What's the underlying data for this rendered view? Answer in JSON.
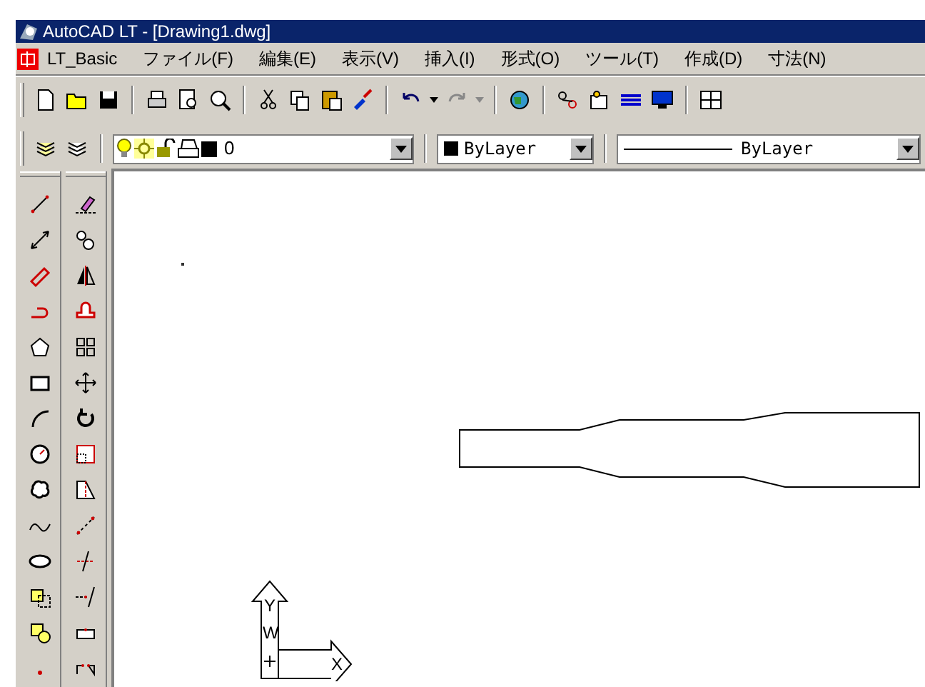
{
  "window": {
    "title": "AutoCAD LT - [Drawing1.dwg]"
  },
  "menu": [
    {
      "label": "LT_Basic"
    },
    {
      "label": "ファイル(F)"
    },
    {
      "label": "編集(E)"
    },
    {
      "label": "表示(V)"
    },
    {
      "label": "挿入(I)"
    },
    {
      "label": "形式(O)"
    },
    {
      "label": "ツール(T)"
    },
    {
      "label": "作成(D)"
    },
    {
      "label": "寸法(N)"
    }
  ],
  "layer_toolbar": {
    "layer": "0",
    "color_setting": "ByLayer",
    "linetype": "ByLayer"
  },
  "ucs_icon": {
    "y": "Y",
    "w": "W",
    "x": "X"
  }
}
